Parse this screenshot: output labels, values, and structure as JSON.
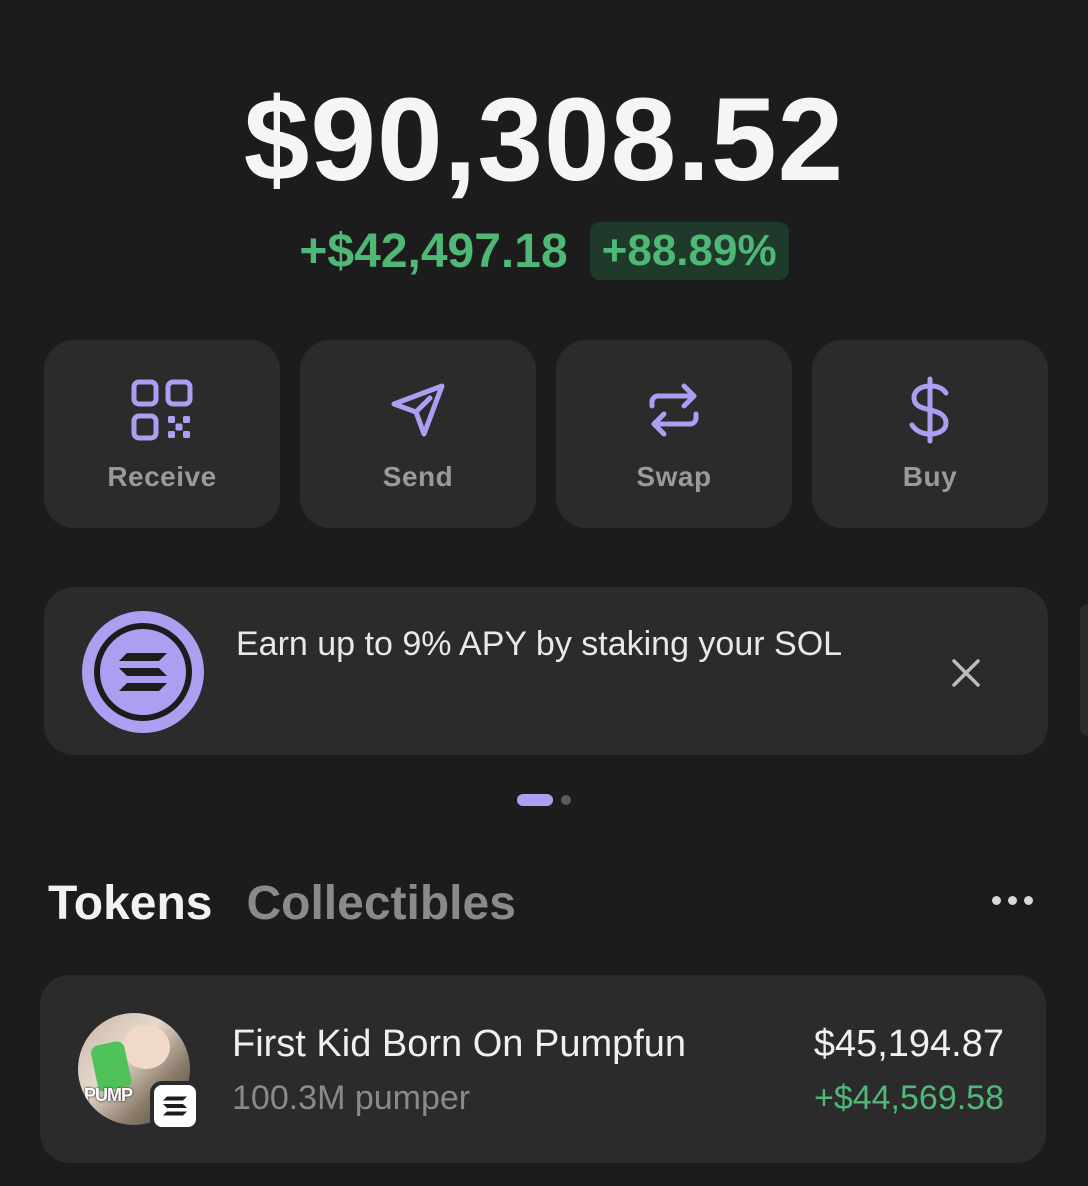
{
  "portfolio": {
    "balance": "$90,308.52",
    "change_amount": "+$42,497.18",
    "change_percent": "+88.89%"
  },
  "actions": [
    {
      "label": "Receive",
      "icon": "qr-code-icon"
    },
    {
      "label": "Send",
      "icon": "send-arrow-icon"
    },
    {
      "label": "Swap",
      "icon": "swap-arrows-icon"
    },
    {
      "label": "Buy",
      "icon": "dollar-icon"
    }
  ],
  "promo": {
    "text": "Earn up to 9% APY by staking your SOL",
    "icon": "solana-logo-icon"
  },
  "tabs": {
    "tokens": "Tokens",
    "collectibles": "Collectibles"
  },
  "tokens": [
    {
      "name": "First Kid Born On Pumpfun",
      "amount": "100.3M pumper",
      "value": "$45,194.87",
      "change": "+$44,569.58",
      "avatar_text": "PUMP"
    }
  ],
  "colors": {
    "background": "#1c1c1c",
    "card": "#2b2b2b",
    "accent": "#ab9ff2",
    "positive": "#4fb877"
  }
}
